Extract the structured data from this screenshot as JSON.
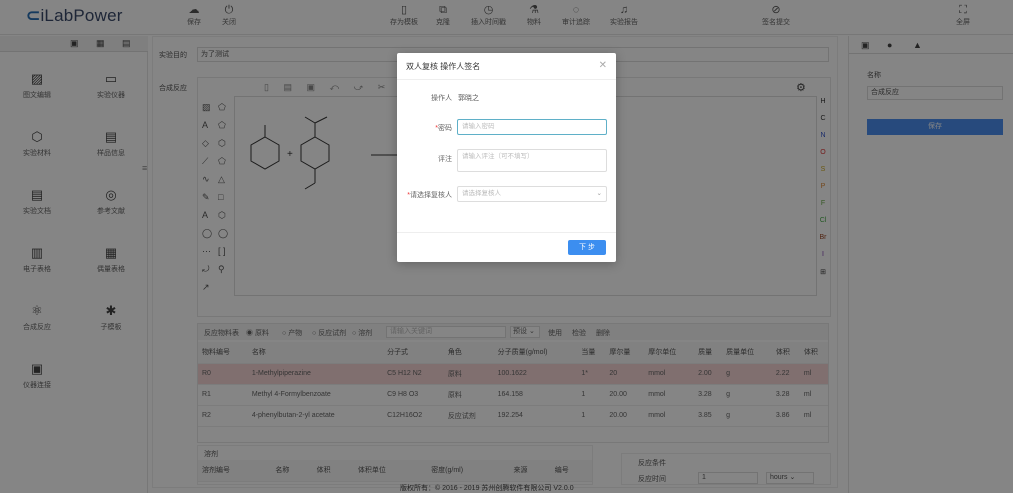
{
  "app": {
    "logo_text": "iLabPower"
  },
  "toolbar_left": [
    {
      "label": "保存",
      "icon": "cloud-save-icon",
      "glyph": "☁"
    },
    {
      "label": "关闭",
      "icon": "power-icon",
      "glyph": "⏻"
    }
  ],
  "toolbar_center": [
    {
      "label": "存为模板",
      "icon": "template-icon",
      "glyph": "▯"
    },
    {
      "label": "克隆",
      "icon": "clone-icon",
      "glyph": "⧉"
    },
    {
      "label": "插入时间戳",
      "icon": "clock-icon",
      "glyph": "◷"
    },
    {
      "label": "物料",
      "icon": "material-icon",
      "glyph": "⚗"
    },
    {
      "label": "审计追踪",
      "icon": "audit-icon",
      "glyph": "◌"
    },
    {
      "label": "实验报告",
      "icon": "report-icon",
      "glyph": "♫"
    },
    {
      "label": "签名提交",
      "icon": "sign-icon",
      "glyph": "⊘"
    },
    {
      "label": "全屏",
      "icon": "fullscreen-icon",
      "glyph": "⛶"
    }
  ],
  "left_nav": {
    "tabs": [
      "list-tab-icon",
      "grid-tab-icon",
      "box-tab-icon"
    ],
    "items": [
      {
        "label": "图文编辑",
        "icon": "image-text-icon",
        "glyph": "▨"
      },
      {
        "label": "实验仪器",
        "icon": "instrument-icon",
        "glyph": "▭"
      },
      {
        "label": "实验材料",
        "icon": "material-hex-icon",
        "glyph": "⬡"
      },
      {
        "label": "样品信息",
        "icon": "sample-doc-icon",
        "glyph": "▤"
      },
      {
        "label": "实验文档",
        "icon": "document-icon",
        "glyph": "▤"
      },
      {
        "label": "参考文献",
        "icon": "reference-icon",
        "glyph": "◎"
      },
      {
        "label": "电子表格",
        "icon": "spreadsheet-icon",
        "glyph": "▥"
      },
      {
        "label": "偶量表格",
        "icon": "table-icon",
        "glyph": "▦"
      },
      {
        "label": "合成反应",
        "icon": "reaction-icon",
        "glyph": "⚛"
      },
      {
        "label": "子模板",
        "icon": "puzzle-icon",
        "glyph": "✱"
      },
      {
        "label": "仪器连接",
        "icon": "device-link-icon",
        "glyph": "▣"
      }
    ]
  },
  "main": {
    "purpose_label": "实验目的",
    "purpose_value": "为了测试",
    "reaction_label": "合成反应",
    "elements": [
      "H",
      "C",
      "N",
      "O",
      "S",
      "P",
      "F",
      "Cl",
      "Br",
      "I",
      "⊞"
    ],
    "element_colors": [
      "#333333",
      "#333333",
      "#3355cc",
      "#dd3333",
      "#ccaa22",
      "#dd8833",
      "#66aa44",
      "#44aa44",
      "#994422",
      "#7733aa",
      "#333333"
    ],
    "reagents": {
      "title": "反应物料表",
      "filters": [
        "原料",
        "产物",
        "反应试剂",
        "溶剂"
      ],
      "search_placeholder": "请输入关键词",
      "preset": "预设",
      "actions": [
        "使用",
        "检验",
        "删除"
      ],
      "columns": [
        "物料编号",
        "名称",
        "分子式",
        "角色",
        "分子质量(g/mol)",
        "当量",
        "摩尔量",
        "摩尔单位",
        "质量",
        "质量单位",
        "体积",
        "体积"
      ],
      "rows": [
        [
          "R0",
          "1-Methylpiperazine",
          "C5 H12 N2",
          "原料",
          "100.1622",
          "1*",
          "20",
          "mmol",
          "2.00",
          "g",
          "2.22",
          "ml"
        ],
        [
          "R1",
          "Methyl 4-Formylbenzoate",
          "C9 H8 O3",
          "原料",
          "164.158",
          "1",
          "20.00",
          "mmol",
          "3.28",
          "g",
          "3.28",
          "ml"
        ],
        [
          "R2",
          "4-phenylbutan-2-yl acetate",
          "C12H16O2",
          "反应试剂",
          "192.254",
          "1",
          "20.00",
          "mmol",
          "3.85",
          "g",
          "3.86",
          "ml"
        ]
      ]
    },
    "solvent": {
      "title": "溶剂",
      "columns": [
        "溶剂编号",
        "名称",
        "体积",
        "体积单位",
        "密度(g/ml)",
        "来源",
        "编号"
      ]
    },
    "conditions": {
      "title": "反应条件",
      "time_label": "反应时间",
      "time_value": "1",
      "time_unit": "hours"
    }
  },
  "right_panel": {
    "name_label": "名称",
    "name_value": "合成反应",
    "confirm_button": "保存"
  },
  "footer": "版权所有：© 2016 - 2019 苏州创腾软件有限公司  V2.0.0",
  "modal": {
    "title": "双人复核   操作人签名",
    "operator_label": "操作人",
    "operator_value": "郭晓之",
    "password_label": "密码",
    "password_placeholder": "请输入密码",
    "comment_label": "评注",
    "comment_placeholder": "请输入评注（可不填写）",
    "reviewer_label": "请选择复核人",
    "reviewer_placeholder": "请选择复核人",
    "next_button": "下 步"
  }
}
